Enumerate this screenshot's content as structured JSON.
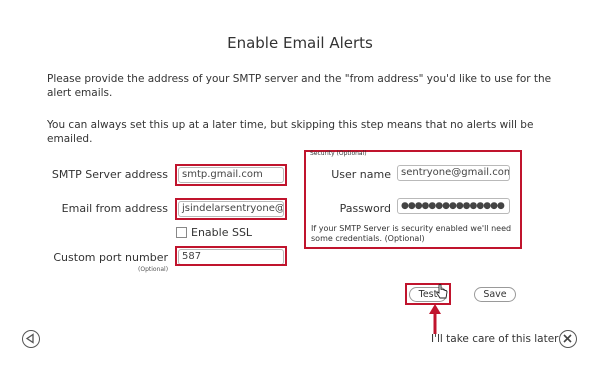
{
  "page": {
    "title": "Enable Email Alerts",
    "intro": "Please provide the address of your SMTP server and the \"from address\" you'd like to use for the alert emails.",
    "note": "You can always set this up at a later time, but skipping this step means that no alerts will be emailed."
  },
  "form": {
    "smtp_label": "SMTP Server address",
    "smtp_value": "smtp.gmail.com",
    "from_label": "Email from address",
    "from_value": "jsindelarsentryone@gmail.com",
    "ssl_label": "Enable SSL",
    "ssl_checked": false,
    "port_label": "Custom port number",
    "port_sub": "(Optional)",
    "port_value": "587"
  },
  "security": {
    "legend": "Security (Optional)",
    "user_label": "User name",
    "user_value": "sentryone@gmail.com",
    "password_label": "Password",
    "password_value": "●●●●●●●●●●●●●●●",
    "note": "If your SMTP Server is security enabled we'll need some credentials. (Optional)"
  },
  "actions": {
    "test_label": "Test",
    "save_label": "Save",
    "skip_label": "I'll take care of this later"
  },
  "colors": {
    "highlight": "#c0142d",
    "text": "#333333"
  },
  "icons": {
    "back": "back-arrow-icon",
    "close": "close-icon",
    "cursor": "hand-cursor-icon",
    "annotation": "annotation-arrow-icon"
  }
}
